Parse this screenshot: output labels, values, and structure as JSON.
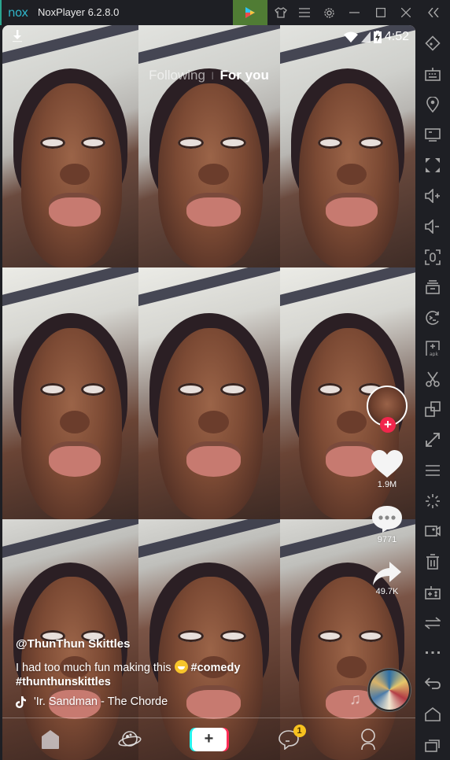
{
  "window": {
    "logo": "nox",
    "title": "NoxPlayer 6.2.8.0",
    "toolbar": [
      {
        "name": "play-store",
        "icon": "play-store-icon"
      },
      {
        "name": "theme",
        "icon": "shirt-icon"
      },
      {
        "name": "menu",
        "icon": "hamburger-icon"
      },
      {
        "name": "settings",
        "icon": "gear-icon"
      },
      {
        "name": "minimize",
        "icon": "minimize-icon"
      },
      {
        "name": "maximize",
        "icon": "maximize-icon"
      },
      {
        "name": "close",
        "icon": "close-icon"
      },
      {
        "name": "collapse-sidebar",
        "icon": "double-chevron-left-icon"
      }
    ],
    "accent_color": "#507c34"
  },
  "status_bar": {
    "time": "4:52",
    "icons": [
      "wifi-icon",
      "signal-icon",
      "battery-charging-icon"
    ]
  },
  "feed": {
    "tabs": [
      {
        "label": "Following",
        "active": false
      },
      {
        "label": "For you",
        "active": true
      }
    ],
    "download_icon": "download-icon"
  },
  "video": {
    "username": "@ThunThun Skittles",
    "description_text": "I had too much fun making this",
    "hashtags": [
      "#comedy",
      "#thunthunskittles"
    ],
    "sound": "Mr. Sandman - The Chorde",
    "sound_visible": "'Ir. Sandman - The Chorde"
  },
  "actions": {
    "likes": "1.9M",
    "comments": "9771",
    "shares": "49.7K",
    "follow_color": "#f1264c"
  },
  "bottom_nav": {
    "items": [
      {
        "name": "home",
        "icon": "home-icon"
      },
      {
        "name": "discover",
        "icon": "planet-icon"
      },
      {
        "name": "create",
        "icon": "plus-icon",
        "label": "+"
      },
      {
        "name": "inbox",
        "icon": "chat-bubble-icon",
        "badge": "1"
      },
      {
        "name": "profile",
        "icon": "person-icon"
      }
    ]
  },
  "nox_sidebar": [
    "rotate-screen",
    "keyboard-control",
    "location",
    "screen-display",
    "fullscreen",
    "volume-up",
    "volume-down",
    "screenshot",
    "multi-instance",
    "sync-operations",
    "install-apk",
    "scissors",
    "multi-window",
    "resize",
    "menu",
    "loading",
    "video-record",
    "delete",
    "gamepad",
    "sync",
    "more",
    "back",
    "home",
    "recent-apps"
  ]
}
